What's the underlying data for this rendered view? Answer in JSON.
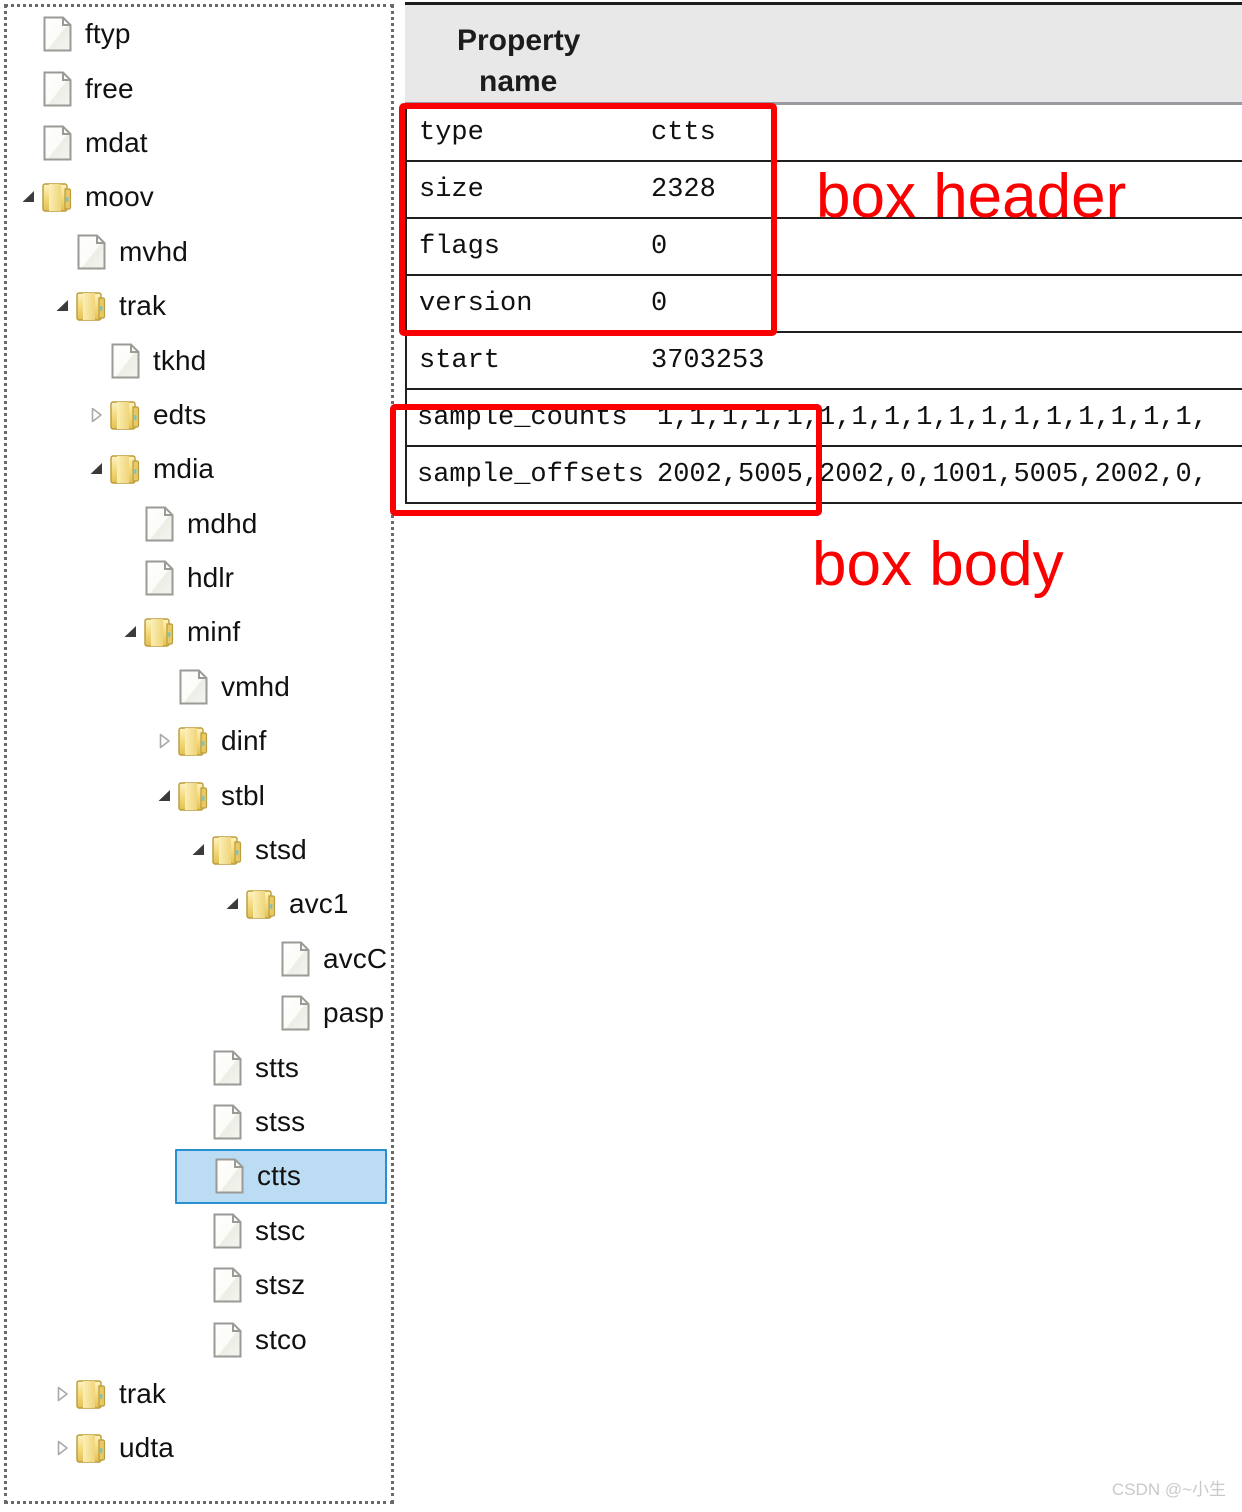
{
  "tree": {
    "nodes": [
      {
        "label": "ftyp",
        "icon": "file-icon",
        "depth": 1,
        "expander": "none",
        "selected": false
      },
      {
        "label": "free",
        "icon": "file-icon",
        "depth": 1,
        "expander": "none",
        "selected": false
      },
      {
        "label": "mdat",
        "icon": "file-icon",
        "depth": 1,
        "expander": "none",
        "selected": false
      },
      {
        "label": "moov",
        "icon": "folder-icon",
        "depth": 1,
        "expander": "expanded",
        "selected": false
      },
      {
        "label": "mvhd",
        "icon": "file-icon",
        "depth": 2,
        "expander": "none",
        "selected": false
      },
      {
        "label": "trak",
        "icon": "folder-icon",
        "depth": 2,
        "expander": "expanded",
        "selected": false
      },
      {
        "label": "tkhd",
        "icon": "file-icon",
        "depth": 3,
        "expander": "none",
        "selected": false
      },
      {
        "label": "edts",
        "icon": "folder-icon",
        "depth": 3,
        "expander": "collapsed",
        "selected": false
      },
      {
        "label": "mdia",
        "icon": "folder-icon",
        "depth": 3,
        "expander": "expanded",
        "selected": false
      },
      {
        "label": "mdhd",
        "icon": "file-icon",
        "depth": 4,
        "expander": "none",
        "selected": false
      },
      {
        "label": "hdlr",
        "icon": "file-icon",
        "depth": 4,
        "expander": "none",
        "selected": false
      },
      {
        "label": "minf",
        "icon": "folder-icon",
        "depth": 4,
        "expander": "expanded",
        "selected": false
      },
      {
        "label": "vmhd",
        "icon": "file-icon",
        "depth": 5,
        "expander": "none",
        "selected": false
      },
      {
        "label": "dinf",
        "icon": "folder-icon",
        "depth": 5,
        "expander": "collapsed",
        "selected": false
      },
      {
        "label": "stbl",
        "icon": "folder-icon",
        "depth": 5,
        "expander": "expanded",
        "selected": false
      },
      {
        "label": "stsd",
        "icon": "folder-icon",
        "depth": 6,
        "expander": "expanded",
        "selected": false
      },
      {
        "label": "avc1",
        "icon": "folder-icon",
        "depth": 7,
        "expander": "expanded",
        "selected": false
      },
      {
        "label": "avcC",
        "icon": "file-icon",
        "depth": 8,
        "expander": "none",
        "selected": false
      },
      {
        "label": "pasp",
        "icon": "file-icon",
        "depth": 8,
        "expander": "none",
        "selected": false
      },
      {
        "label": "stts",
        "icon": "file-icon",
        "depth": 6,
        "expander": "none",
        "selected": false
      },
      {
        "label": "stss",
        "icon": "file-icon",
        "depth": 6,
        "expander": "none",
        "selected": false
      },
      {
        "label": "ctts",
        "icon": "file-icon",
        "depth": 6,
        "expander": "none",
        "selected": true
      },
      {
        "label": "stsc",
        "icon": "file-icon",
        "depth": 6,
        "expander": "none",
        "selected": false
      },
      {
        "label": "stsz",
        "icon": "file-icon",
        "depth": 6,
        "expander": "none",
        "selected": false
      },
      {
        "label": "stco",
        "icon": "file-icon",
        "depth": 6,
        "expander": "none",
        "selected": false
      },
      {
        "label": "trak",
        "icon": "folder-icon",
        "depth": 2,
        "expander": "collapsed",
        "selected": false
      },
      {
        "label": "udta",
        "icon": "folder-icon",
        "depth": 2,
        "expander": "collapsed",
        "selected": false
      }
    ]
  },
  "table": {
    "header_line1": "Property",
    "header_line2": "name",
    "rows": [
      {
        "name": "type",
        "value": "ctts"
      },
      {
        "name": "size",
        "value": "2328"
      },
      {
        "name": "flags",
        "value": "0"
      },
      {
        "name": "version",
        "value": "0"
      },
      {
        "name": "start",
        "value": "3703253"
      },
      {
        "name": "sample_counts",
        "value": "1,1,1,1,1,1,1,1,1,1,1,1,1,1,1,1,1,"
      },
      {
        "name": "sample_offsets",
        "value": "2002,5005,2002,0,1001,5005,2002,0,"
      }
    ]
  },
  "annotations": {
    "box_header_label": "box header",
    "box_body_label": "box body",
    "annotation_color": "#fb0000"
  },
  "watermark": {
    "text": "CSDN @~小生"
  },
  "colors": {
    "selection_fill": "#bbdcf2",
    "selection_border": "#2a8fd0",
    "header_background": "#e8e8e8",
    "folder_yellow": "#f2d675"
  }
}
